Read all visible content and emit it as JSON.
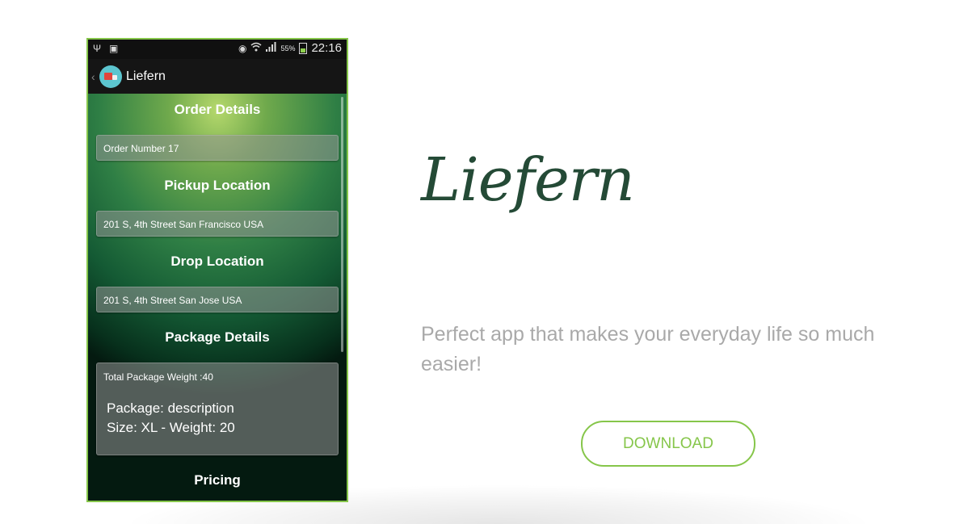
{
  "phone": {
    "status_bar": {
      "time": "22:16",
      "battery_percent": "55%",
      "icons_left": [
        "usb-icon",
        "image-icon"
      ],
      "icons_right": [
        "eye-icon",
        "wifi-icon",
        "signal-icon",
        "battery-icon"
      ]
    },
    "action_bar": {
      "title": "Liefern"
    },
    "sections": {
      "order_details_heading": "Order Details",
      "order_number": "Order Number 17",
      "pickup_heading": "Pickup Location",
      "pickup_address": "201 S, 4th Street San Francisco USA",
      "drop_heading": "Drop Location",
      "drop_address": "201 S, 4th Street San Jose USA",
      "package_heading": "Package Details",
      "package_weight": "Total Package Weight :40",
      "package_desc_line1": "Package: description",
      "package_desc_line2": "Size: XL - Weight: 20",
      "pricing_heading": "Pricing"
    }
  },
  "hero": {
    "title": "Liefern",
    "subtitle": "Perfect app that makes your everyday life so much easier!",
    "download_label": "DOWNLOAD"
  },
  "colors": {
    "accent": "#86c64a",
    "title": "#244a36",
    "subtitle": "#a9a9a9"
  }
}
